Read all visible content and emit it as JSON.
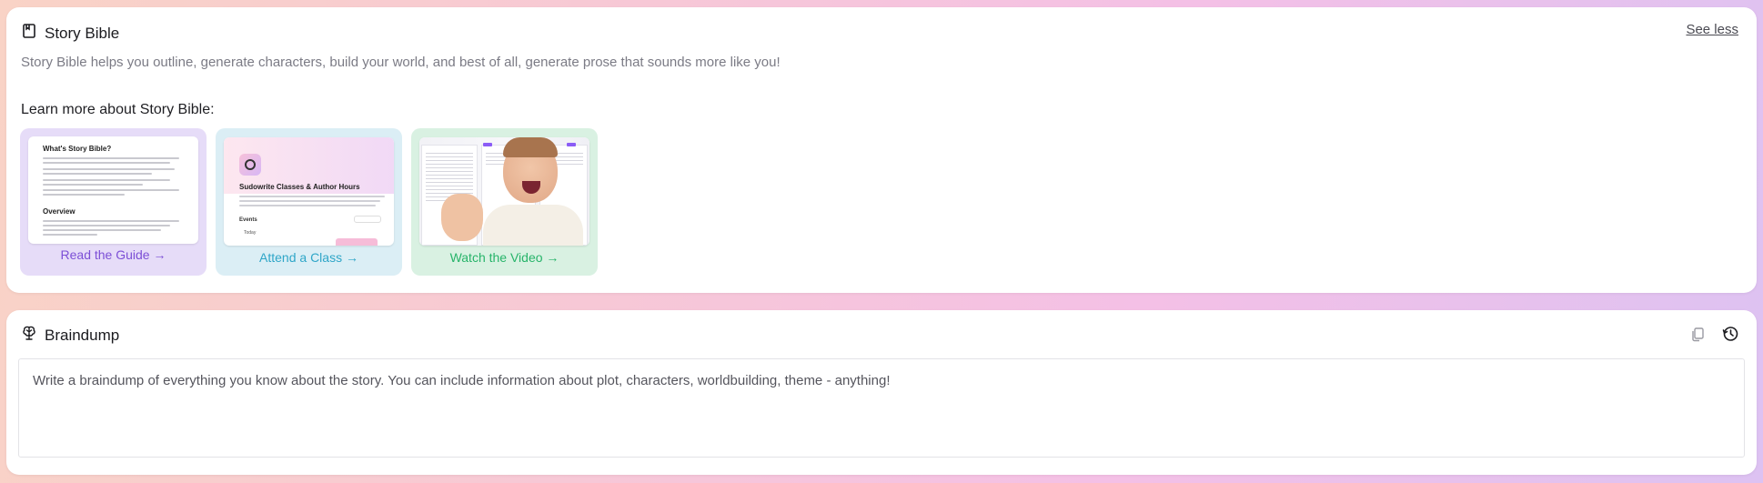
{
  "story_bible": {
    "title": "Story Bible",
    "toggle_label": "See less",
    "description": "Story Bible helps you outline, generate characters, build your world, and best of all, generate prose that sounds more like you!",
    "learn_more_heading": "Learn more about Story Bible:",
    "cards": [
      {
        "label": "Read the Guide →",
        "accent": "#7c4fd6",
        "background": "#e6dcf8"
      },
      {
        "label": "Attend a Class →",
        "accent": "#2fa6c8",
        "background": "#dbeef5"
      },
      {
        "label": "Watch the Video →",
        "accent": "#27b46a",
        "background": "#d9f1e2"
      }
    ],
    "guide_thumbnail": {
      "heading": "What's Story Bible?",
      "subheading": "Overview"
    },
    "class_thumbnail": {
      "title": "Sudowrite Classes & Author Hours",
      "events_label": "Events",
      "today_label": "Today"
    }
  },
  "braindump": {
    "title": "Braindump",
    "placeholder": "Write a braindump of everything you know about the story. You can include information about plot, characters, worldbuilding, theme - anything!",
    "value": "",
    "icons": [
      "copy-icon",
      "history-icon"
    ]
  }
}
